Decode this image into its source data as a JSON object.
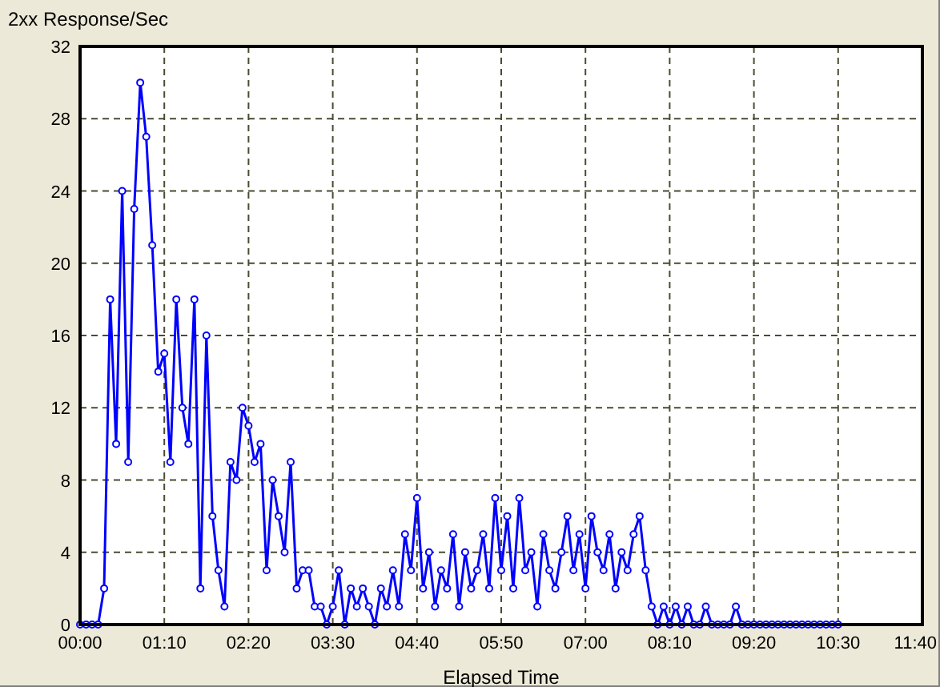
{
  "panel": {
    "chart_data": {
      "type": "line",
      "title": "2xx Response/Sec",
      "xlabel": "Elapsed Time",
      "grid": true,
      "x": [
        0,
        5,
        10,
        15,
        20,
        25,
        30,
        35,
        40,
        45,
        50,
        55,
        60,
        65,
        70,
        75,
        80,
        85,
        90,
        95,
        100,
        105,
        110,
        115,
        120,
        125,
        130,
        135,
        140,
        145,
        150,
        155,
        160,
        165,
        170,
        175,
        180,
        185,
        190,
        195,
        200,
        205,
        210,
        215,
        220,
        225,
        230,
        235,
        240,
        245,
        250,
        255,
        260,
        265,
        270,
        275,
        280,
        285,
        290,
        295,
        300,
        305,
        310,
        315,
        320,
        325,
        330,
        335,
        340,
        345,
        350,
        355,
        360,
        365,
        370,
        375,
        380,
        385,
        390,
        395,
        400,
        405,
        410,
        415,
        420,
        425,
        430,
        435,
        440,
        445,
        450,
        455,
        460,
        465,
        470,
        475,
        480,
        485,
        490,
        495,
        500,
        505,
        510,
        515,
        520,
        525,
        530,
        535,
        540,
        545,
        550,
        555,
        560,
        565,
        570,
        575,
        580,
        585,
        590,
        595,
        600,
        605,
        610,
        615,
        620,
        625,
        630
      ],
      "series": [
        {
          "color": "#0000ff",
          "marker": "circle",
          "values": [
            0,
            0,
            0,
            0,
            2,
            18,
            10,
            24,
            9,
            23,
            30,
            27,
            21,
            14,
            15,
            9,
            18,
            12,
            10,
            18,
            2,
            16,
            6,
            3,
            1,
            9,
            8,
            12,
            11,
            9,
            10,
            3,
            8,
            6,
            4,
            9,
            2,
            3,
            3,
            1,
            1,
            0,
            1,
            3,
            0,
            2,
            1,
            2,
            1,
            0,
            2,
            1,
            3,
            1,
            5,
            3,
            7,
            2,
            4,
            1,
            3,
            2,
            5,
            1,
            4,
            2,
            3,
            5,
            2,
            7,
            3,
            6,
            2,
            7,
            3,
            4,
            1,
            5,
            3,
            2,
            4,
            6,
            3,
            5,
            2,
            6,
            4,
            3,
            5,
            2,
            4,
            3,
            5,
            6,
            3,
            1,
            0,
            1,
            0,
            1,
            0,
            1,
            0,
            0,
            1,
            0,
            0,
            0,
            0,
            1,
            0,
            0,
            0,
            0,
            0,
            0,
            0,
            0,
            0,
            0,
            0,
            0,
            0,
            0,
            0,
            0,
            0
          ]
        }
      ],
      "xlim": [
        0,
        700
      ],
      "ylim": [
        0,
        32
      ],
      "xticks": [
        {
          "value": 0,
          "label": "00:00"
        },
        {
          "value": 70,
          "label": "01:10"
        },
        {
          "value": 140,
          "label": "02:20"
        },
        {
          "value": 210,
          "label": "03:30"
        },
        {
          "value": 280,
          "label": "04:40"
        },
        {
          "value": 350,
          "label": "05:50"
        },
        {
          "value": 420,
          "label": "07:00"
        },
        {
          "value": 490,
          "label": "08:10"
        },
        {
          "value": 560,
          "label": "09:20"
        },
        {
          "value": 630,
          "label": "10:30"
        },
        {
          "value": 700,
          "label": "11:40"
        }
      ],
      "yticks": [
        0,
        4,
        8,
        12,
        16,
        20,
        24,
        28,
        32
      ]
    }
  }
}
